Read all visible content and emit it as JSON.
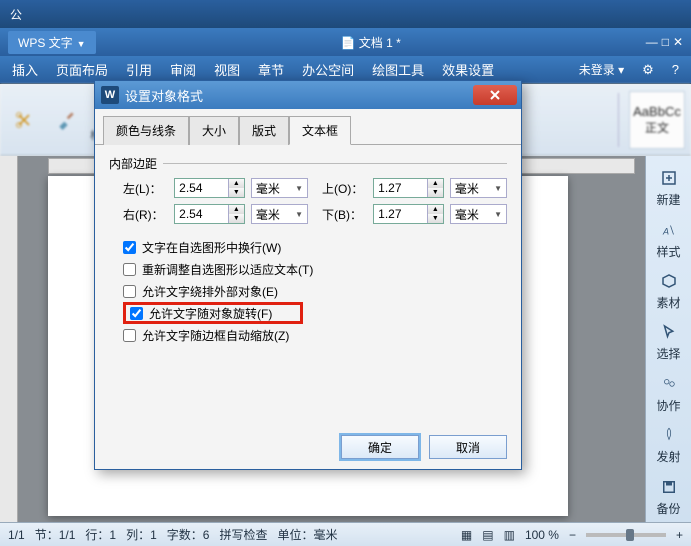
{
  "window": {
    "appChar": "公"
  },
  "appbar": {
    "title": "WPS 文字",
    "docname": "文档 1 *"
  },
  "winctrl": {
    "min": "—",
    "max": "□",
    "close": "✕"
  },
  "menu": {
    "items": [
      "插入",
      "页面布局",
      "引用",
      "审阅",
      "视图",
      "章节",
      "办公空间",
      "绘图工具",
      "效果设置"
    ],
    "login": "未登录 ▾",
    "gear": "⚙"
  },
  "toolbar": {
    "formatBrush": "格式刷",
    "stylePreview": "AaBbCc",
    "styleName": "正文"
  },
  "sidepanel": {
    "items": [
      {
        "label": "新建",
        "icon": "plus"
      },
      {
        "label": "样式",
        "icon": "style"
      },
      {
        "label": "素材",
        "icon": "box"
      },
      {
        "label": "选择",
        "icon": "cursor"
      },
      {
        "label": "协作",
        "icon": "people"
      },
      {
        "label": "发射",
        "icon": "rocket"
      },
      {
        "label": "备份",
        "icon": "disk"
      }
    ]
  },
  "dialog": {
    "title": "设置对象格式",
    "tabs": [
      "颜色与线条",
      "大小",
      "版式",
      "文本框"
    ],
    "activeTab": 3,
    "section": "内部边距",
    "fields": {
      "leftLabel": "左(L)：",
      "leftVal": "2.54",
      "rightLabel": "右(R)：",
      "rightVal": "2.54",
      "topLabel": "上(O)：",
      "topVal": "1.27",
      "bottomLabel": "下(B)：",
      "bottomVal": "1.27",
      "unit": "毫米"
    },
    "checks": [
      {
        "label": "文字在自选图形中换行(W)",
        "checked": true
      },
      {
        "label": "重新调整自选图形以适应文本(T)",
        "checked": false
      },
      {
        "label": "允许文字绕排外部对象(E)",
        "checked": false
      },
      {
        "label": "允许文字随对象旋转(F)",
        "checked": true,
        "highlight": true
      },
      {
        "label": "允许文字随边框自动缩放(Z)",
        "checked": false
      }
    ],
    "ok": "确定",
    "cancel": "取消"
  },
  "status": {
    "page": "1/1",
    "section": "节：1/1",
    "row": "行：1",
    "col": "列：1",
    "chars": "字数：6",
    "spell": "拼写检查",
    "unit": "单位：毫米",
    "zoom": "100 %"
  }
}
